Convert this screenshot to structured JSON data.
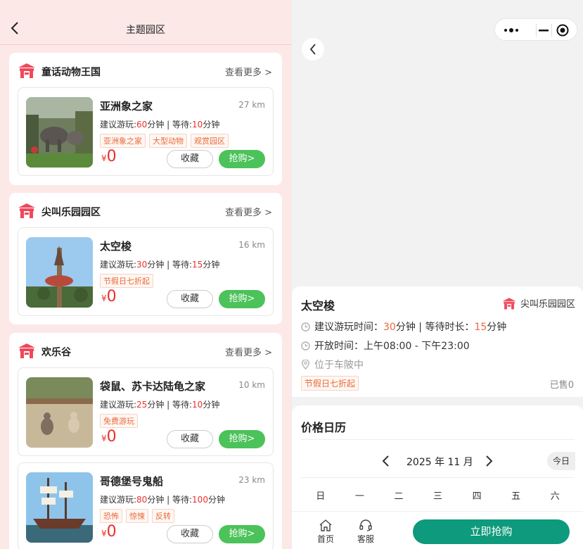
{
  "left": {
    "title": "主题园区",
    "more_label": "查看更多 >",
    "fav_label": "收藏",
    "buy_label": "抢购>",
    "currency": "¥",
    "sections": [
      {
        "title": "童话动物王国",
        "cards": [
          {
            "name": "亚洲象之家",
            "distance": "27 km",
            "play_prefix": "建议游玩:",
            "play": "60",
            "play_unit": "分钟 | 等待:",
            "wait": "10",
            "wait_unit": "分钟",
            "tags": [
              "亚洲象之家",
              "大型动物",
              "观赏园区"
            ],
            "price": "0"
          }
        ]
      },
      {
        "title": "尖叫乐园园区",
        "cards": [
          {
            "name": "太空梭",
            "distance": "16 km",
            "play_prefix": "建议游玩:",
            "play": "30",
            "play_unit": "分钟 | 等待:",
            "wait": "15",
            "wait_unit": "分钟",
            "tags": [
              "节假日七折起"
            ],
            "price": "0"
          }
        ]
      },
      {
        "title": "欢乐谷",
        "cards": [
          {
            "name": "袋鼠、苏卡达陆龟之家",
            "distance": "10 km",
            "play_prefix": "建议游玩:",
            "play": "25",
            "play_unit": "分钟 | 等待:",
            "wait": "10",
            "wait_unit": "分钟",
            "tags": [
              "免费游玩"
            ],
            "price": "0"
          },
          {
            "name": "哥德堡号鬼船",
            "distance": "23 km",
            "play_prefix": "建议游玩:",
            "play": "80",
            "play_unit": "分钟 | 等待:",
            "wait": "100",
            "wait_unit": "分钟",
            "tags": [
              "恐怖",
              "惊悚",
              "反转"
            ],
            "price": "0"
          }
        ]
      }
    ]
  },
  "detail": {
    "name": "太空梭",
    "park": "尖叫乐园园区",
    "play_label": "建议游玩时间：",
    "play": "30",
    "play_unit": "分钟 | 等待时长：",
    "wait": "15",
    "wait_unit": "分钟",
    "hours": "开放时间：上午08:00 - 下午23:00",
    "location": "位于车陂中",
    "tag": "节假日七折起",
    "sold": "已售0"
  },
  "calendar": {
    "title": "价格日历",
    "month": "2025 年 11 月",
    "today": "今日",
    "weekdays": [
      "日",
      "一",
      "二",
      "三",
      "四",
      "五",
      "六"
    ]
  },
  "bottombar": {
    "home": "首页",
    "service": "客服",
    "cta": "立即抢购"
  },
  "colors": {
    "accent_red": "#e8312a",
    "buy_green": "#4cc25a",
    "cta_teal": "#0e9a7c",
    "tag_orange": "#e86a3a",
    "left_bg": "#fde8e8"
  }
}
